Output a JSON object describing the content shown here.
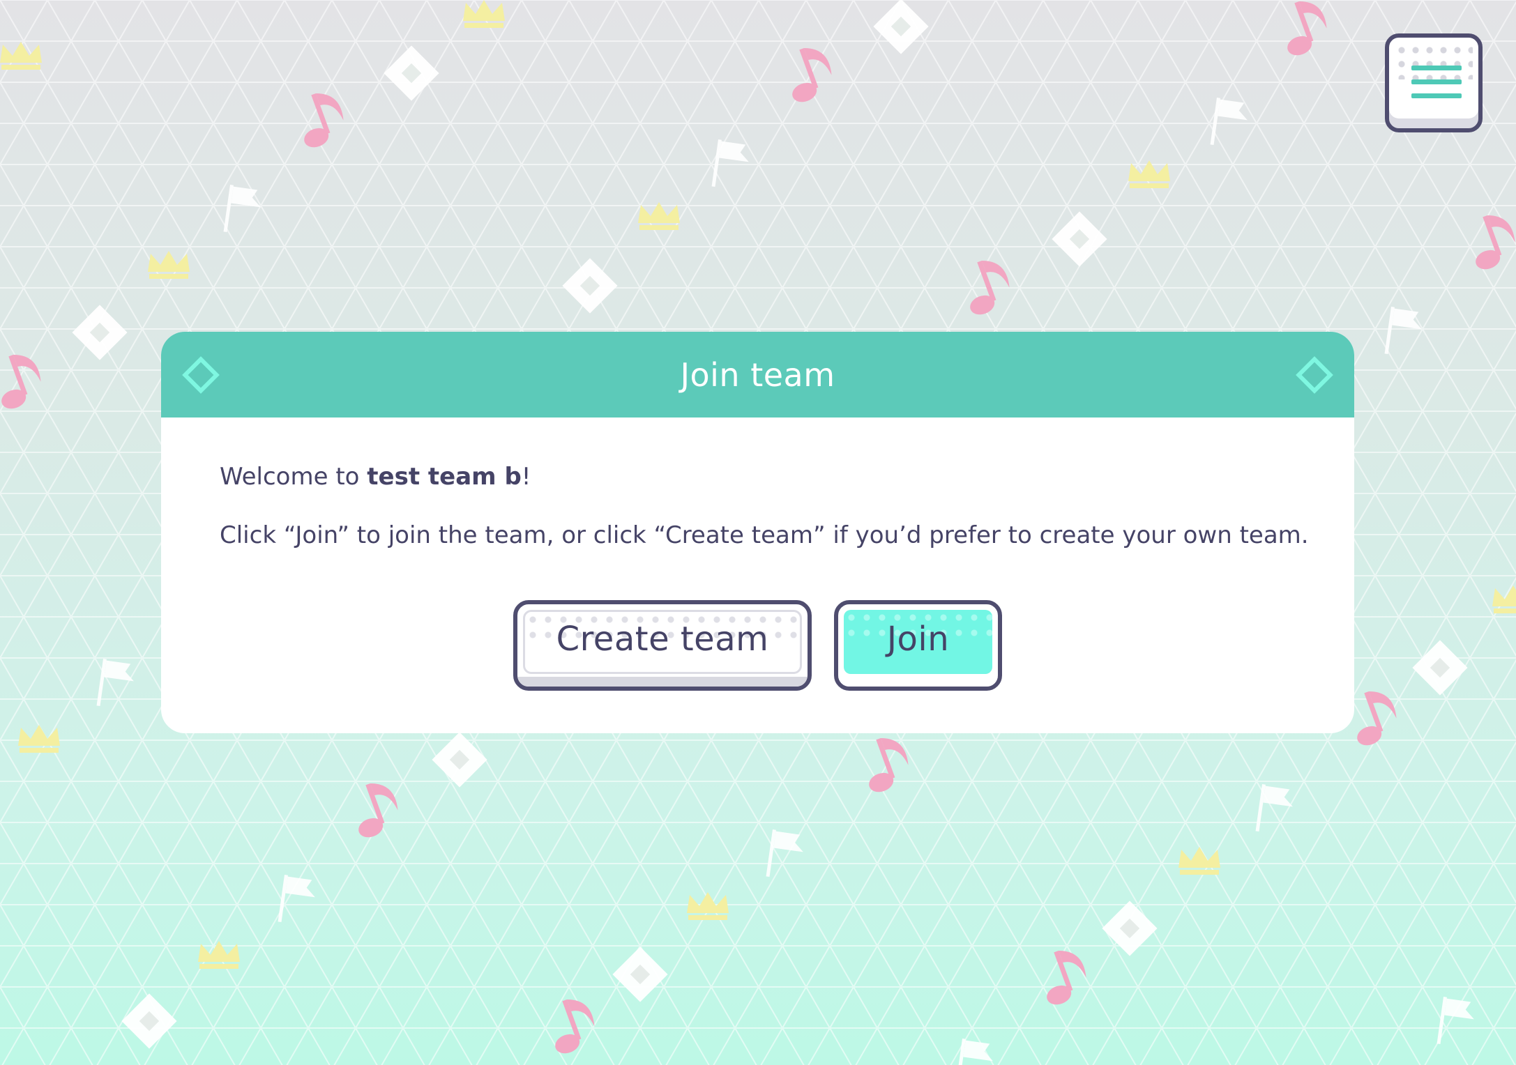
{
  "dialog": {
    "title": "Join team",
    "welcome_prefix": "Welcome to ",
    "team_name": "test team b",
    "welcome_suffix": "!",
    "instructions": "Click “Join” to join the team, or click “Create team” if you’d prefer to create your own team."
  },
  "buttons": {
    "create_label": "Create team",
    "join_label": "Join"
  },
  "icons": {
    "menu": "hamburger-menu-icon",
    "header_decoration": "diamond-icon",
    "background_motifs": [
      "music-note-icon",
      "crown-icon",
      "flag-icon",
      "diamond-icon"
    ]
  },
  "colors": {
    "header": "#5ccab9",
    "join_accent": "#72f6e4",
    "outline": "#4f4d6f",
    "text": "#454366",
    "note": "#f2a6c2",
    "crown": "#f4efa1",
    "flag_diamond": "#ffffff"
  }
}
